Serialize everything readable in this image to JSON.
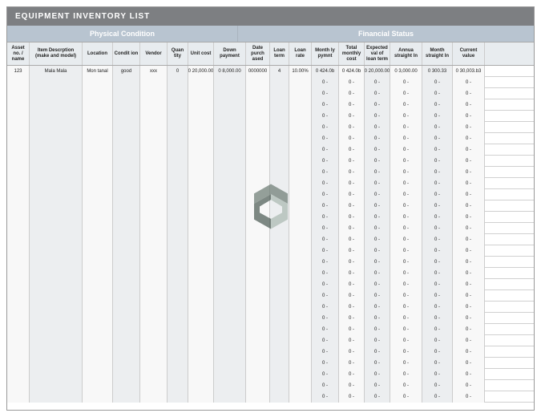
{
  "title": "EQUIPMENT INVENTORY LIST",
  "sections": {
    "physical": "Physical Condition",
    "financial": "Financial Status"
  },
  "headers": [
    "Asset no. / name",
    "Item Descrption (make and model)",
    "Location",
    "Condit ion",
    "Vendor",
    "Quan tity",
    "Unit cost",
    "Down payment",
    "Date purch ased",
    "Loan term",
    "Loan rate",
    "Month ly pymnt",
    "Total monthly cost",
    "Expected val of loan term",
    "Annua straight ln",
    "Month straight ln",
    "Current value"
  ],
  "row0": {
    "c0": "123",
    "c1": "Mala Mala",
    "c2": "Mon tanal",
    "c3": "good",
    "c4": "xxx",
    "c5": "0",
    "c6": "0 20,000.00",
    "c7": "0 8,000.00",
    "c8": "0000000",
    "c9": "4",
    "c10": "10.00%",
    "c11": "0 424.0b",
    "c12": "0 424.0b",
    "c13": "0 20,000.00",
    "c14": "0 3,000.00",
    "c15": "0 300.33",
    "c16": "0 30,003.b3"
  },
  "empty": {
    "dash": "-",
    "zero": "0"
  },
  "chart_data": {
    "type": "table",
    "title": "EQUIPMENT INVENTORY LIST",
    "columns": [
      "Asset no./name",
      "Item Description (make and model)",
      "Location",
      "Condition",
      "Vendor",
      "Quantity",
      "Unit cost",
      "Down payment",
      "Date purchased",
      "Loan term",
      "Loan rate",
      "Monthly pymnt",
      "Total monthly cost",
      "Expected val of loan term",
      "Annual straight ln",
      "Monthly straight ln",
      "Current value"
    ],
    "rows": [
      [
        "123",
        "Mala Mala",
        "Mon tanal",
        "good",
        "xxx",
        0,
        20000.0,
        8000.0,
        "0000000",
        4,
        0.1,
        424.0,
        424.0,
        20000.0,
        3000.0,
        300.33,
        30003.0
      ]
    ]
  }
}
